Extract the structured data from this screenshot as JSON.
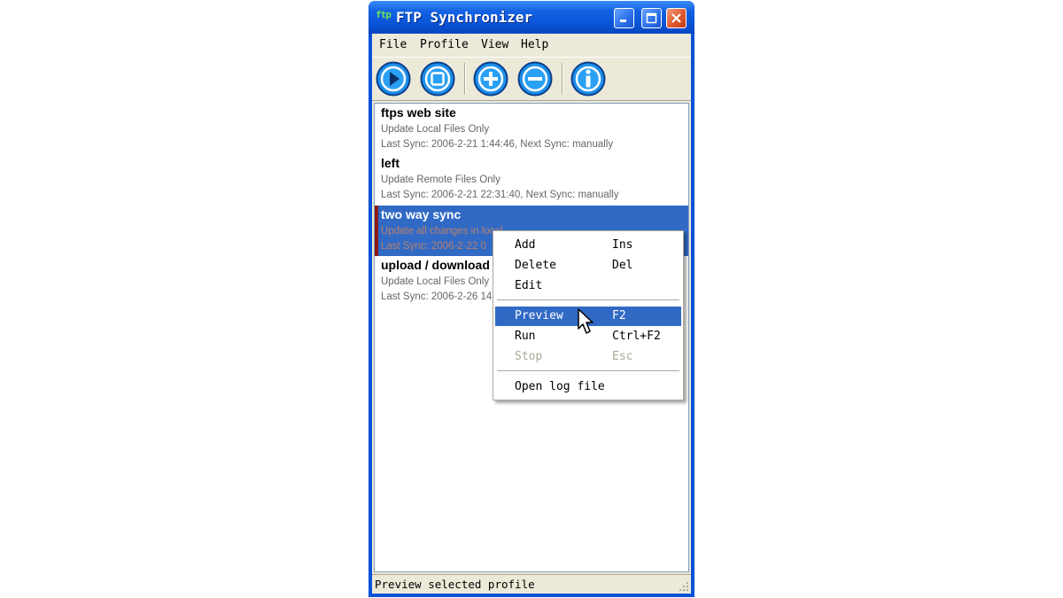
{
  "window": {
    "title": "FTP Synchronizer",
    "title_icon": "ftp",
    "controls": [
      "minimize-icon",
      "maximize-icon",
      "close-icon"
    ]
  },
  "menubar": {
    "items": [
      "File",
      "Profile",
      "View",
      "Help"
    ]
  },
  "toolbar": {
    "buttons": [
      "run-icon",
      "stop-icon",
      "add-icon",
      "remove-icon",
      "info-icon"
    ]
  },
  "profiles": [
    {
      "name": "ftps web site",
      "mode": "Update Local Files Only",
      "sync": "Last Sync: 2006-2-21 1:44:46, Next Sync: manually"
    },
    {
      "name": "left",
      "mode": "Update Remote Files Only",
      "sync": "Last Sync: 2006-2-21 22:31:40, Next Sync: manually"
    },
    {
      "name": "two way sync",
      "mode": "Update all changes in local...",
      "sync": "Last Sync: 2006-2-22 0"
    },
    {
      "name": "upload / download",
      "mode": "Update Local Files Only",
      "sync": "Last Sync: 2006-2-26 14"
    }
  ],
  "context_menu": {
    "items": [
      {
        "label": "Add",
        "shortcut": "Ins"
      },
      {
        "label": "Delete",
        "shortcut": "Del"
      },
      {
        "label": "Edit",
        "shortcut": ""
      },
      {
        "label": "Preview",
        "shortcut": "F2"
      },
      {
        "label": "Run",
        "shortcut": "Ctrl+F2"
      },
      {
        "label": "Stop",
        "shortcut": "Esc"
      },
      {
        "label": "Open log file",
        "shortcut": ""
      }
    ]
  },
  "statusbar": {
    "text": "Preview selected profile"
  },
  "colors": {
    "titlebar": "#0a54d6",
    "selection": "#316ac5",
    "face": "#ece9d8"
  }
}
